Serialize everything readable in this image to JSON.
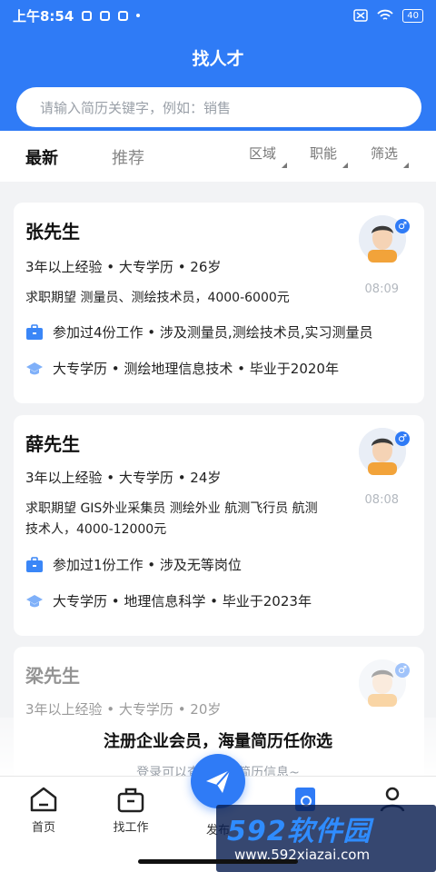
{
  "status_bar": {
    "time": "上午8:54",
    "battery": "40"
  },
  "header": {
    "title": "找人才",
    "search_placeholder": "请输入简历关键字，例如：销售"
  },
  "tabs": {
    "latest": "最新",
    "recommend": "推荐"
  },
  "filters": [
    "区域",
    "职能",
    "筛选"
  ],
  "resumes": [
    {
      "name": "张先生",
      "meta": "3年以上经验 • 大专学历 • 26岁",
      "expect": "求职期望 测量员、测绘技术员，4000-6000元",
      "time": "08:09",
      "work": "参加过4份工作 • 涉及测量员,测绘技术员,实习测量员",
      "edu": "大专学历 • 测绘地理信息技术 • 毕业于2020年"
    },
    {
      "name": "薛先生",
      "meta": "3年以上经验 • 大专学历 • 24岁",
      "expect": "求职期望 GIS外业采集员 测绘外业 航测飞行员 航测技术人，4000-12000元",
      "time": "08:08",
      "work": "参加过1份工作 • 涉及无等岗位",
      "edu": "大专学历 • 地理信息科学 • 毕业于2023年"
    },
    {
      "name": "梁先生",
      "meta": "3年以上经验 • 大专学历 • 20岁"
    }
  ],
  "promo": {
    "title": "注册企业会员，海量简历任你选",
    "subtitle": "登录可以查看更多简历信息~"
  },
  "nav": {
    "home": "首页",
    "jobs": "找工作",
    "post": "发布"
  },
  "watermark": {
    "brand": "592软件园",
    "url": "www.592xiazai.com"
  },
  "colors": {
    "brand": "#2f7bf6",
    "background": "#f2f3f5"
  }
}
